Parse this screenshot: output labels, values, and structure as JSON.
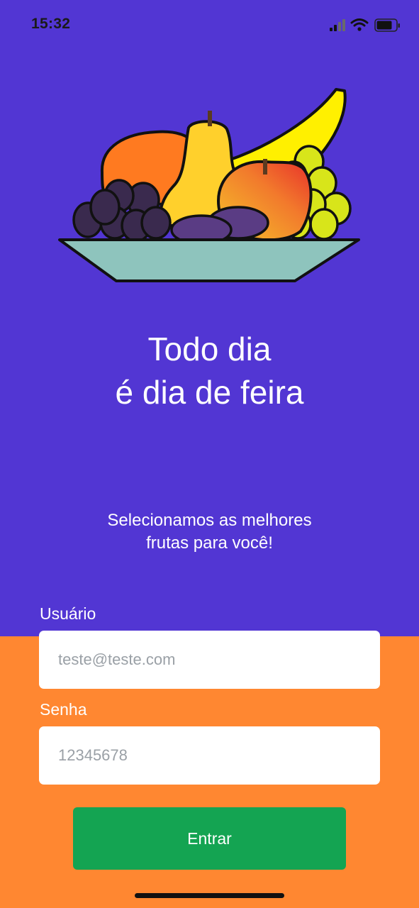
{
  "status_bar": {
    "time": "15:32",
    "icons": [
      "cellular-signal-icon",
      "wifi-icon",
      "battery-icon"
    ]
  },
  "hero": {
    "illustration": "fruit-bowl-illustration",
    "headline_line1": "Todo dia",
    "headline_line2": "é dia de feira",
    "subtitle_line1": "Selecionamos as melhores",
    "subtitle_line2": "frutas para você!"
  },
  "form": {
    "username_label": "Usuário",
    "username_placeholder": "teste@teste.com",
    "password_label": "Senha",
    "password_placeholder": "12345678",
    "submit_label": "Entrar"
  },
  "colors": {
    "primary_background": "#5236D3",
    "secondary_background": "#FF8731",
    "button": "#14A452",
    "input_background": "#FFFFFF",
    "text_on_primary": "#FFFFFF"
  }
}
